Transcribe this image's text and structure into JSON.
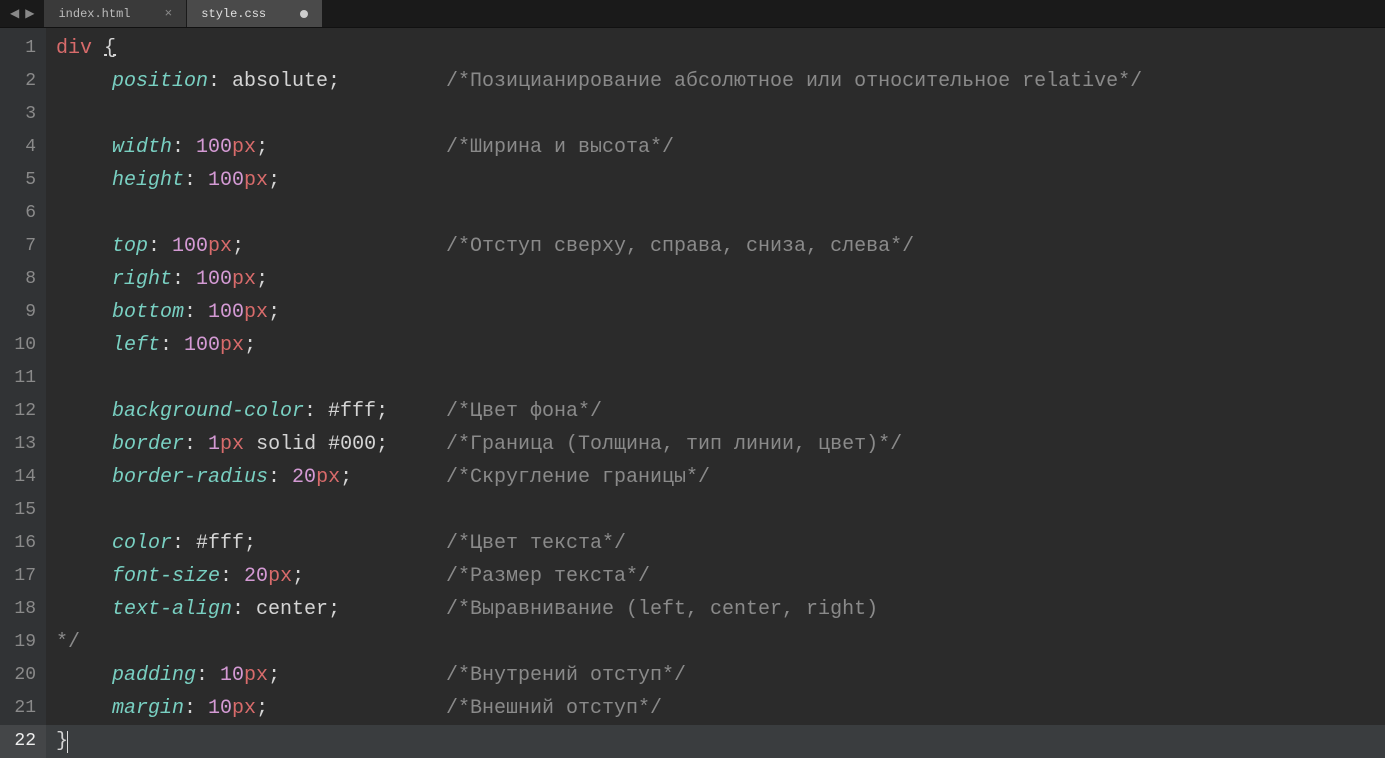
{
  "tabs": {
    "items": [
      {
        "label": "index.html",
        "active": false,
        "dirty": false
      },
      {
        "label": "style.css",
        "active": true,
        "dirty": true
      }
    ]
  },
  "gutter": {
    "lines": [
      "1",
      "2",
      "3",
      "4",
      "5",
      "6",
      "7",
      "8",
      "9",
      "10",
      "11",
      "12",
      "13",
      "14",
      "15",
      "16",
      "17",
      "18",
      "19",
      "20",
      "21",
      "22"
    ],
    "current": 22
  },
  "code": {
    "selector": "div",
    "brace_open": "{",
    "brace_close": "}",
    "colon": ":",
    "semi": ";",
    "space": " ",
    "lines": {
      "l2": {
        "prop": "position",
        "val": "absolute",
        "comment": "/*Позицианирование абсолютное или относительное relative*/"
      },
      "l4": {
        "prop": "width",
        "num": "100",
        "unit": "px",
        "comment": "/*Ширина и высота*/"
      },
      "l5": {
        "prop": "height",
        "num": "100",
        "unit": "px"
      },
      "l7": {
        "prop": "top",
        "num": "100",
        "unit": "px",
        "comment": "/*Отступ сверху, справа, сниза, слева*/"
      },
      "l8": {
        "prop": "right",
        "num": "100",
        "unit": "px"
      },
      "l9": {
        "prop": "bottom",
        "num": "100",
        "unit": "px"
      },
      "l10": {
        "prop": "left",
        "num": "100",
        "unit": "px"
      },
      "l12": {
        "prop": "background-color",
        "val": "#fff",
        "comment": "/*Цвет фона*/"
      },
      "l13": {
        "prop": "border",
        "num": "1",
        "unit": "px",
        "kw": "solid",
        "val2": "#000",
        "comment": "/*Граница (Толщина, тип линии, цвет)*/"
      },
      "l14": {
        "prop": "border-radius",
        "num": "20",
        "unit": "px",
        "comment": "/*Скругление границы*/"
      },
      "l16": {
        "prop": "color",
        "val": "#fff",
        "comment": "/*Цвет текста*/"
      },
      "l17": {
        "prop": "font-size",
        "num": "20",
        "unit": "px",
        "comment": "/*Размер текста*/"
      },
      "l18": {
        "prop": "text-align",
        "val": "center",
        "comment": "/*Выравнивание (left, center, right)"
      },
      "l19": {
        "comment_tail": "*/"
      },
      "l20": {
        "prop": "padding",
        "num": "10",
        "unit": "px",
        "comment": "/*Внутрений отступ*/"
      },
      "l21": {
        "prop": "margin",
        "num": "10",
        "unit": "px",
        "comment": "/*Внешний отступ*/"
      }
    },
    "comment_col": 390
  }
}
